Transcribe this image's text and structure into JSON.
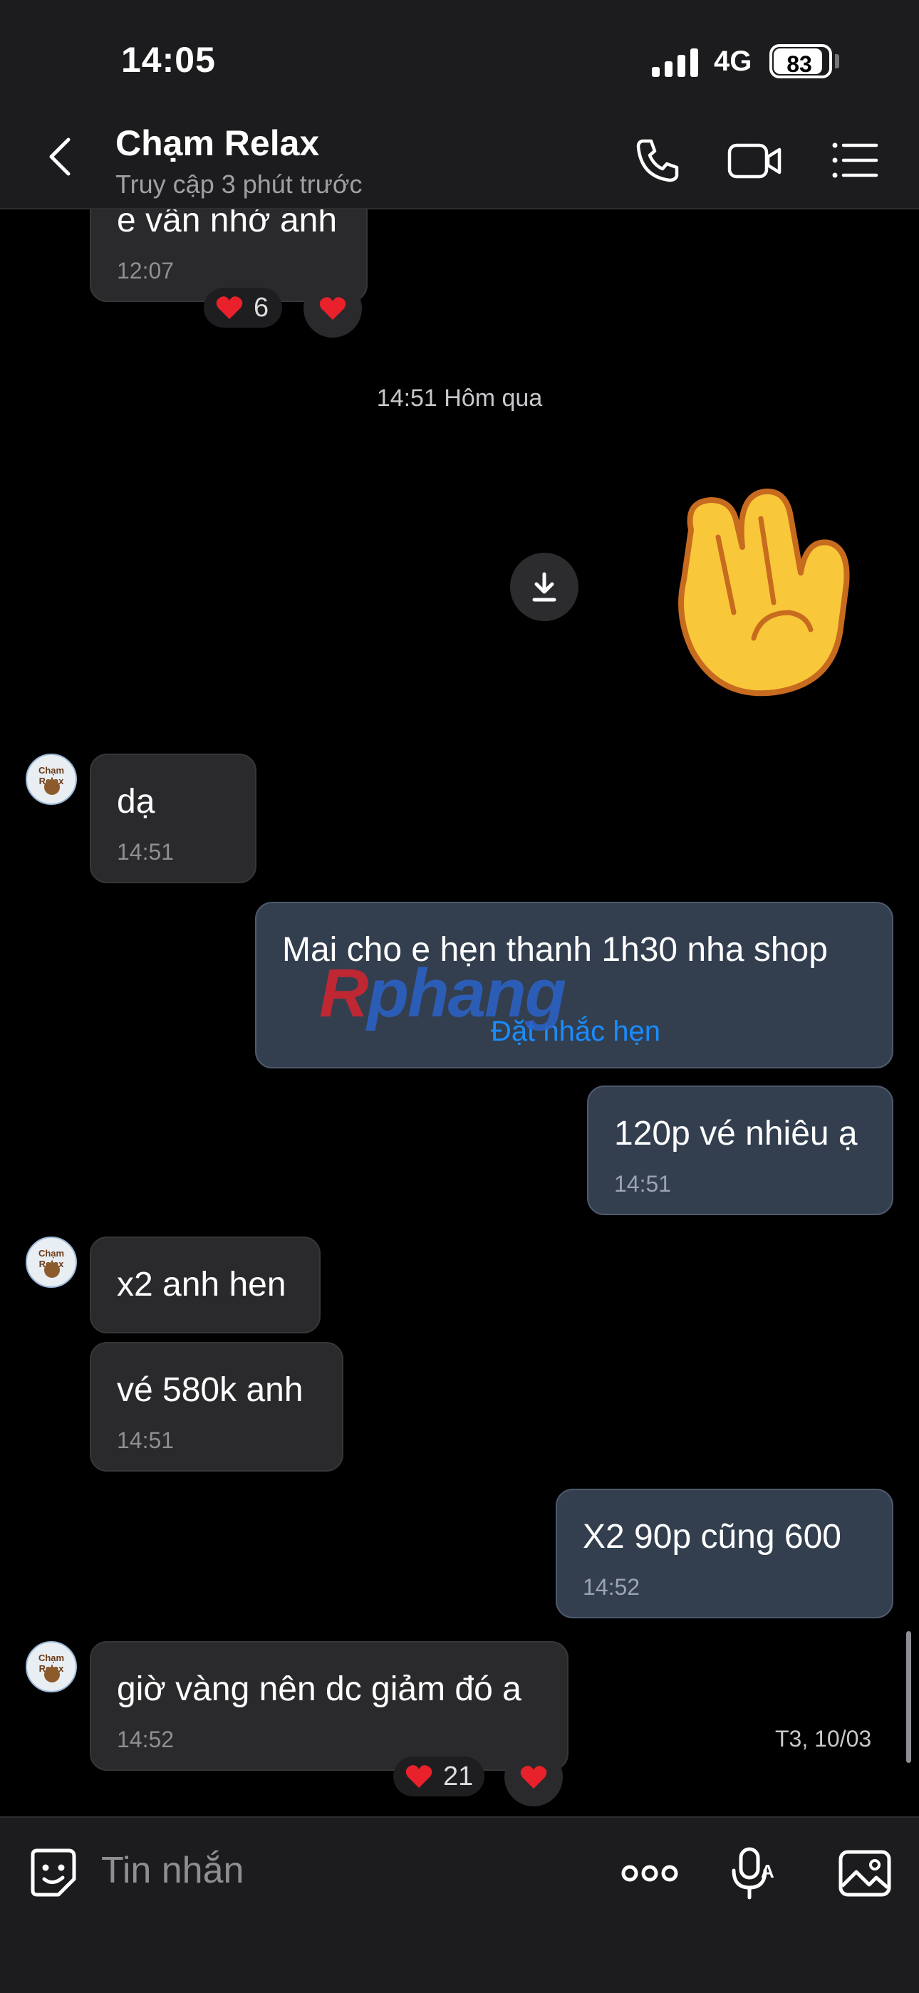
{
  "status_bar": {
    "time": "14:05",
    "network": "4G",
    "battery": "83"
  },
  "header": {
    "title": "Chạm Relax",
    "subtitle": "Truy cập 3 phút trước",
    "icons": [
      "back-icon",
      "phone-icon",
      "video-icon",
      "menu-icon"
    ]
  },
  "messages": [
    {
      "side": "left",
      "text": "e vẫn nhớ anh",
      "time": "12:07",
      "reaction_count": "6"
    },
    {
      "side": "right",
      "type": "sticker",
      "sticker": "raised-hand"
    },
    {
      "side": "left",
      "text": "dạ",
      "time": "14:51"
    },
    {
      "side": "right",
      "text": "Mai  cho e hẹn thanh 1h30 nha shop",
      "action": "Đặt nhắc hẹn"
    },
    {
      "side": "right",
      "text": "120p vé nhiêu ạ",
      "time": "14:51"
    },
    {
      "side": "left",
      "text": "x2 anh hen"
    },
    {
      "side": "left",
      "text": "vé 580k anh",
      "time": "14:51"
    },
    {
      "side": "right",
      "text": "X2 90p cũng 600",
      "time": "14:52"
    },
    {
      "side": "left",
      "text": "giờ vàng nên dc giảm đó a",
      "time": "14:52",
      "reaction_count": "21"
    }
  ],
  "divider": "14:51 Hôm qua",
  "date_label": "T3, 10/03",
  "avatar_label": "Chạm Relax",
  "watermark": {
    "part1": "R",
    "part2": "phang"
  },
  "input": {
    "placeholder": "Tin nhắn",
    "icons": [
      "sticker-icon",
      "more-icon",
      "voice-icon",
      "image-icon"
    ]
  },
  "colors": {
    "background": "#000000",
    "bar": "#1c1c1e",
    "bubble_in": "#2a2a2c",
    "bubble_out": "#333f4f",
    "link": "#1a8cff"
  }
}
